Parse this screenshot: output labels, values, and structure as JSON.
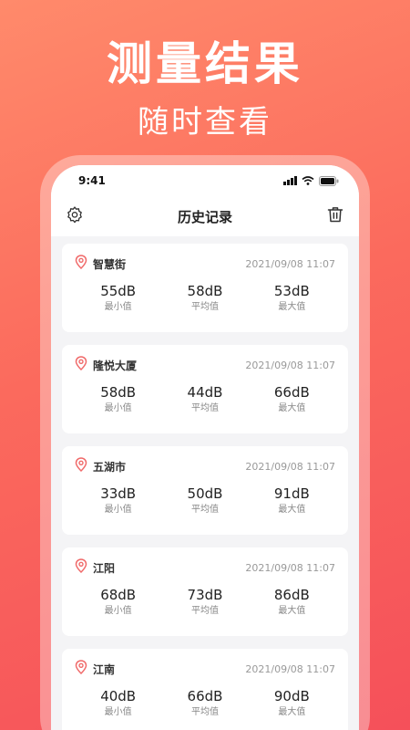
{
  "hero": {
    "title": "测量结果",
    "subtitle": "随时查看"
  },
  "status_bar": {
    "time": "9:41"
  },
  "nav": {
    "title": "历史记录",
    "settings_icon": "gear-icon",
    "delete_icon": "trash-icon"
  },
  "labels": {
    "min": "最小值",
    "avg": "平均值",
    "max": "最大值"
  },
  "records": [
    {
      "location": "智慧街",
      "time": "2021/09/08 11:07",
      "min": "55dB",
      "avg": "58dB",
      "max": "53dB"
    },
    {
      "location": "隆悦大厦",
      "time": "2021/09/08 11:07",
      "min": "58dB",
      "avg": "44dB",
      "max": "66dB"
    },
    {
      "location": "五湖市",
      "time": "2021/09/08 11:07",
      "min": "33dB",
      "avg": "50dB",
      "max": "91dB"
    },
    {
      "location": "江阳",
      "time": "2021/09/08 11:07",
      "min": "68dB",
      "avg": "73dB",
      "max": "86dB"
    },
    {
      "location": "江南",
      "time": "2021/09/08 11:07",
      "min": "40dB",
      "avg": "66dB",
      "max": "90dB"
    }
  ],
  "colors": {
    "accent": "#f5505a",
    "pin": "#f06a6a"
  }
}
